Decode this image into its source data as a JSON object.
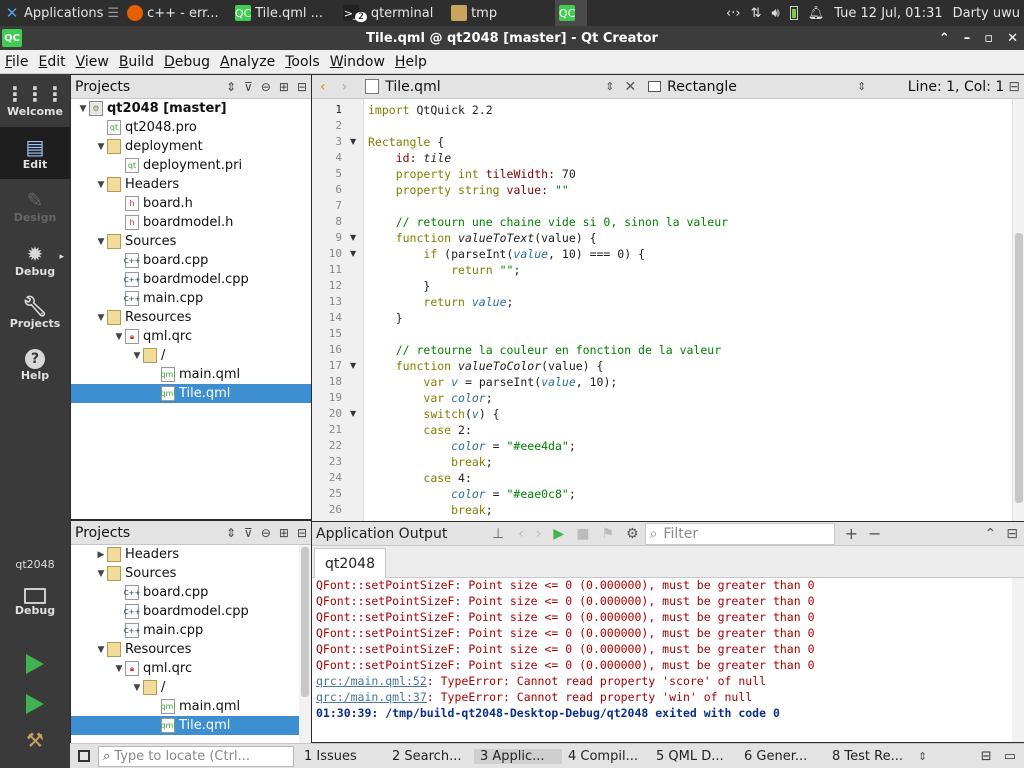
{
  "taskbar": {
    "apps_label": "Applications",
    "apps_sep": "☰",
    "tasks": [
      {
        "icon": "firefox-icon",
        "label": "c++ - err..."
      },
      {
        "icon": "qtcreator-icon",
        "label": "Tile.qml ..."
      },
      {
        "icon": "terminal-icon",
        "label": "qterminal",
        "badge": "2"
      },
      {
        "icon": "folder-icon",
        "label": "tmp"
      },
      {
        "icon": "qtcreator-icon",
        "label": ""
      }
    ],
    "clock": "Tue 12 Jul, 01:31",
    "user": "Darty uwu"
  },
  "window": {
    "title": "Tile.qml @ qt2048 [master] - Qt Creator",
    "app_icon_text": "QC"
  },
  "menu": [
    "File",
    "Edit",
    "View",
    "Build",
    "Debug",
    "Analyze",
    "Tools",
    "Window",
    "Help"
  ],
  "modes": [
    {
      "label": "Welcome",
      "icon": "welcome-icon"
    },
    {
      "label": "Edit",
      "icon": "edit-icon",
      "active": true
    },
    {
      "label": "Design",
      "icon": "design-icon",
      "disabled": true
    },
    {
      "label": "Debug",
      "icon": "debug-icon"
    },
    {
      "label": "Projects",
      "icon": "projects-icon"
    },
    {
      "label": "Help",
      "icon": "help-icon"
    }
  ],
  "kit": {
    "name": "qt2048",
    "mode": "Debug"
  },
  "projects_top": {
    "title": "Projects",
    "rows": [
      {
        "depth": 0,
        "arrow": "▼",
        "icon": "proj",
        "label": "qt2048 [master]",
        "bold": true
      },
      {
        "depth": 1,
        "arrow": "",
        "icon": "pro",
        "label": "qt2048.pro"
      },
      {
        "depth": 1,
        "arrow": "▼",
        "icon": "folder",
        "label": "deployment"
      },
      {
        "depth": 2,
        "arrow": "",
        "icon": "pri",
        "label": "deployment.pri"
      },
      {
        "depth": 1,
        "arrow": "▼",
        "icon": "folder",
        "label": "Headers"
      },
      {
        "depth": 2,
        "arrow": "",
        "icon": "h",
        "label": "board.h"
      },
      {
        "depth": 2,
        "arrow": "",
        "icon": "h",
        "label": "boardmodel.h"
      },
      {
        "depth": 1,
        "arrow": "▼",
        "icon": "folder",
        "label": "Sources"
      },
      {
        "depth": 2,
        "arrow": "",
        "icon": "cpp",
        "label": "board.cpp"
      },
      {
        "depth": 2,
        "arrow": "",
        "icon": "cpp",
        "label": "boardmodel.cpp"
      },
      {
        "depth": 2,
        "arrow": "",
        "icon": "cpp",
        "label": "main.cpp"
      },
      {
        "depth": 1,
        "arrow": "▼",
        "icon": "folder",
        "label": "Resources"
      },
      {
        "depth": 2,
        "arrow": "▼",
        "icon": "qrc",
        "label": "qml.qrc"
      },
      {
        "depth": 3,
        "arrow": "▼",
        "icon": "folder",
        "label": "/"
      },
      {
        "depth": 4,
        "arrow": "",
        "icon": "qml",
        "label": "main.qml"
      },
      {
        "depth": 4,
        "arrow": "",
        "icon": "qml",
        "label": "Tile.qml",
        "selected": true
      }
    ]
  },
  "projects_bottom": {
    "title": "Projects",
    "rows": [
      {
        "depth": 1,
        "arrow": "▶",
        "icon": "folder",
        "label": "Headers"
      },
      {
        "depth": 1,
        "arrow": "▼",
        "icon": "folder",
        "label": "Sources"
      },
      {
        "depth": 2,
        "arrow": "",
        "icon": "cpp",
        "label": "board.cpp"
      },
      {
        "depth": 2,
        "arrow": "",
        "icon": "cpp",
        "label": "boardmodel.cpp"
      },
      {
        "depth": 2,
        "arrow": "",
        "icon": "cpp",
        "label": "main.cpp"
      },
      {
        "depth": 1,
        "arrow": "▼",
        "icon": "folder",
        "label": "Resources"
      },
      {
        "depth": 2,
        "arrow": "▼",
        "icon": "qrc",
        "label": "qml.qrc"
      },
      {
        "depth": 3,
        "arrow": "▼",
        "icon": "folder",
        "label": "/"
      },
      {
        "depth": 4,
        "arrow": "",
        "icon": "qml",
        "label": "main.qml"
      },
      {
        "depth": 4,
        "arrow": "",
        "icon": "qml",
        "label": "Tile.qml",
        "selected": true
      }
    ]
  },
  "editor": {
    "file": "Tile.qml",
    "symbol": "Rectangle",
    "position": "Line: 1, Col: 1",
    "lines": [
      {
        "n": 1,
        "html": "<span class=\"kw\">import</span> QtQuick 2.2"
      },
      {
        "n": 2,
        "html": ""
      },
      {
        "n": 3,
        "fold": true,
        "html": "<span class=\"typ\">Rectangle</span> {"
      },
      {
        "n": 4,
        "html": "    <span class=\"prop\">id</span>: <span class=\"it\">tile</span>"
      },
      {
        "n": 5,
        "html": "    <span class=\"kw\">property</span> <span class=\"kw\">int</span> <span class=\"prop\">tileWidth</span>: 70"
      },
      {
        "n": 6,
        "html": "    <span class=\"kw\">property</span> <span class=\"kw\">string</span> <span class=\"prop\">value</span>: <span class=\"st\">\"\"</span>"
      },
      {
        "n": 7,
        "html": ""
      },
      {
        "n": 8,
        "html": "    <span class=\"cm\">// retourn une chaine vide si 0, sinon la valeur</span>"
      },
      {
        "n": 9,
        "fold": true,
        "html": "    <span class=\"kw\">function</span> <span class=\"it\">valueToText</span>(value) {"
      },
      {
        "n": 10,
        "fold": true,
        "html": "        <span class=\"kw\">if</span> (parseInt(<span class=\"vr\">value</span>, 10) === 0) {"
      },
      {
        "n": 11,
        "html": "            <span class=\"kw\">return</span> <span class=\"st\">\"\"</span>;"
      },
      {
        "n": 12,
        "html": "        }"
      },
      {
        "n": 13,
        "html": "        <span class=\"kw\">return</span> <span class=\"vr\">value</span>;"
      },
      {
        "n": 14,
        "html": "    }"
      },
      {
        "n": 15,
        "html": ""
      },
      {
        "n": 16,
        "html": "    <span class=\"cm\">// retourne la couleur en fonction de la valeur</span>"
      },
      {
        "n": 17,
        "fold": true,
        "html": "    <span class=\"kw\">function</span> <span class=\"it\">valueToColor</span>(value) {"
      },
      {
        "n": 18,
        "html": "        <span class=\"kw\">var</span> <span class=\"vr\">v</span> = parseInt(<span class=\"vr\">value</span>, 10);"
      },
      {
        "n": 19,
        "html": "        <span class=\"kw\">var</span> <span class=\"vr\">color</span>;"
      },
      {
        "n": 20,
        "fold": true,
        "html": "        <span class=\"kw\">switch</span>(<span class=\"vr\">v</span>) {"
      },
      {
        "n": 21,
        "html": "        <span class=\"kw\">case</span> 2:"
      },
      {
        "n": 22,
        "html": "            <span class=\"vr\">color</span> = <span class=\"st\">\"#eee4da\"</span>;"
      },
      {
        "n": 23,
        "html": "            <span class=\"kw\">break</span>;"
      },
      {
        "n": 24,
        "html": "        <span class=\"kw\">case</span> 4:"
      },
      {
        "n": 25,
        "html": "            <span class=\"vr\">color</span> = <span class=\"st\">\"#eae0c8\"</span>;"
      },
      {
        "n": 26,
        "html": "            <span class=\"kw\">break</span>;"
      }
    ]
  },
  "output": {
    "title": "Application Output",
    "filter_placeholder": "Filter",
    "tab": "qt2048",
    "lines": [
      {
        "kind": "err",
        "text": "QFont::setPointSizeF: Point size <= 0 (0.000000), must be greater than 0"
      },
      {
        "kind": "err",
        "text": "QFont::setPointSizeF: Point size <= 0 (0.000000), must be greater than 0"
      },
      {
        "kind": "err",
        "text": "QFont::setPointSizeF: Point size <= 0 (0.000000), must be greater than 0"
      },
      {
        "kind": "err",
        "text": "QFont::setPointSizeF: Point size <= 0 (0.000000), must be greater than 0"
      },
      {
        "kind": "err",
        "text": "QFont::setPointSizeF: Point size <= 0 (0.000000), must be greater than 0"
      },
      {
        "kind": "err",
        "text": "QFont::setPointSizeF: Point size <= 0 (0.000000), must be greater than 0"
      },
      {
        "kind": "link",
        "link": "qrc:/main.qml:52",
        "text": ": TypeError: Cannot read property 'score' of null"
      },
      {
        "kind": "link",
        "link": "qrc:/main.qml:37",
        "text": ": TypeError: Cannot read property 'win' of null"
      },
      {
        "kind": "fin",
        "text": "01:30:39: /tmp/build-qt2048-Desktop-Debug/qt2048 exited with code 0"
      }
    ]
  },
  "status": {
    "locator_placeholder": "Type to locate (Ctrl...",
    "tabs": [
      "1 Issues",
      "2 Search...",
      "3 Applic...",
      "4 Compil...",
      "5 QML D...",
      "6 Gener...",
      "8 Test Re..."
    ],
    "active_tab": 2
  }
}
